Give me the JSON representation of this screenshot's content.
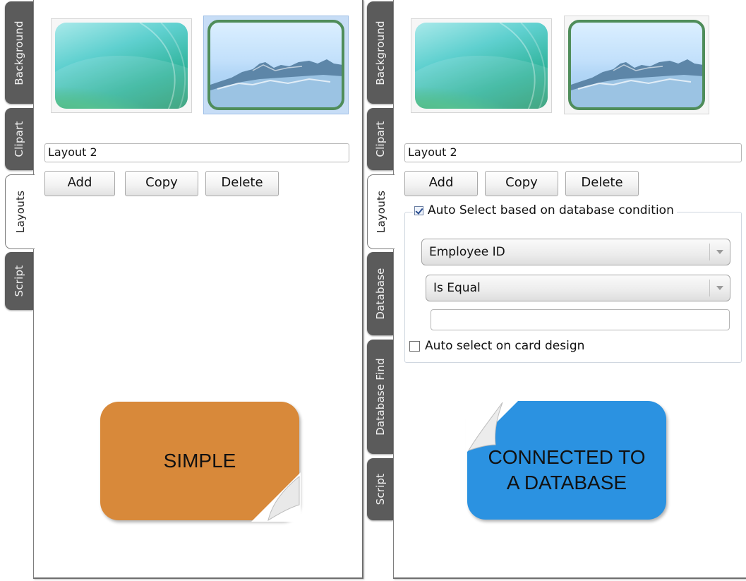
{
  "left_panel": {
    "tabs": [
      "Background",
      "Clipart",
      "Layouts",
      "Script"
    ],
    "active_tab": "Layouts",
    "layout_name": "Layout 2",
    "buttons": {
      "add": "Add",
      "copy": "Copy",
      "delete": "Delete"
    },
    "badge": "SIMPLE"
  },
  "right_panel": {
    "tabs": [
      "Background",
      "Clipart",
      "Layouts",
      "Database",
      "Database Find",
      "Script"
    ],
    "active_tab": "Layouts",
    "layout_name": "Layout 2",
    "buttons": {
      "add": "Add",
      "copy": "Copy",
      "delete": "Delete"
    },
    "auto_select": {
      "label": "Auto Select based on database condition",
      "checked": true,
      "field": "Employee ID",
      "operator": "Is Equal",
      "value": ""
    },
    "auto_select_card_design": {
      "label": "Auto select on card design",
      "checked": false
    },
    "badge_line1": "CONNECTED TO",
    "badge_line2": "A DATABASE"
  },
  "colors": {
    "tab_inactive": "#5b5b5b",
    "selection": "#c7ddf6",
    "badge_simple": "#d8893a",
    "badge_database": "#2b92e1"
  }
}
